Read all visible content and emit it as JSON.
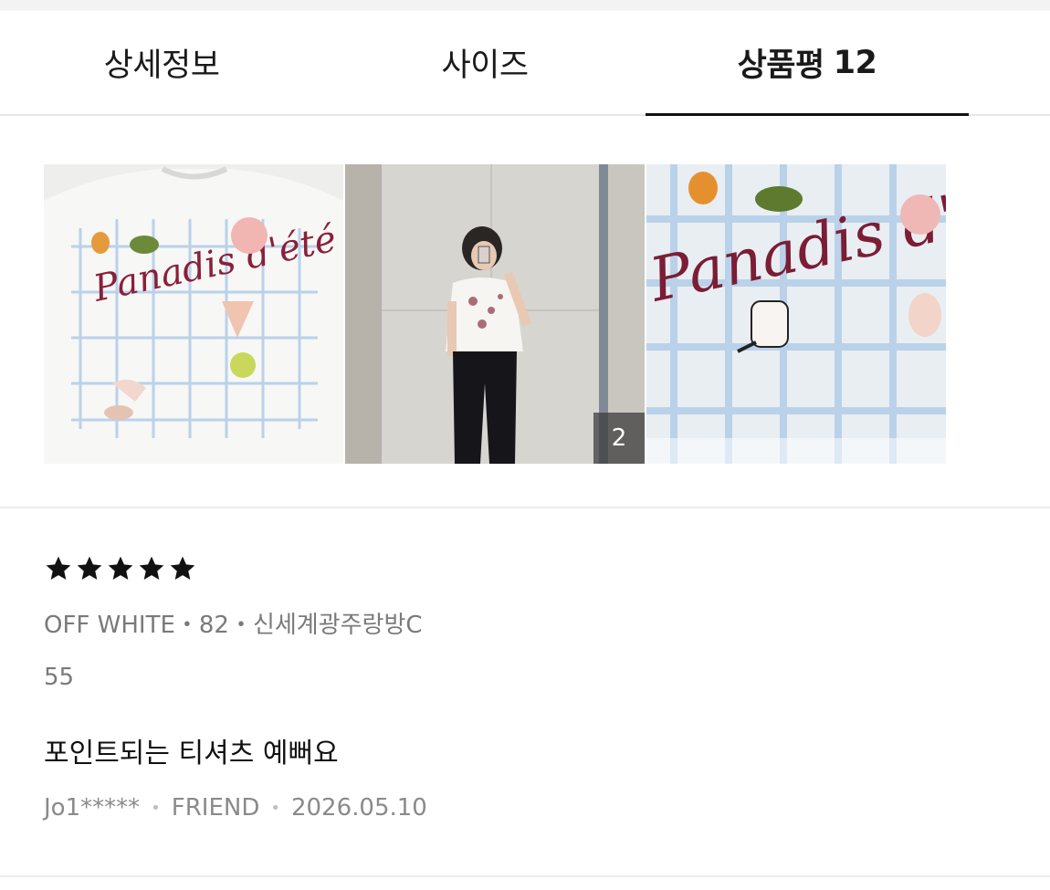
{
  "tabs": [
    {
      "label": "상세정보"
    },
    {
      "label": "사이즈"
    },
    {
      "label": "상품평",
      "count": "12"
    }
  ],
  "photos": {
    "second_count": "2",
    "items": [
      {
        "icon": "shirt-closeup-photo",
        "lettering": "Panadis d'été"
      },
      {
        "icon": "mirror-selfie-photo"
      },
      {
        "icon": "print-detail-photo",
        "lettering": "Panadis d'été"
      }
    ]
  },
  "review": {
    "rating": 5,
    "option": "OFF WHITE・82・신세계광주랑방C",
    "size": "55",
    "text": "포인트되는 티셔츠 예뻐요",
    "author": "Jo1*****",
    "grade": "FRIEND",
    "date": "2026.05.10"
  }
}
